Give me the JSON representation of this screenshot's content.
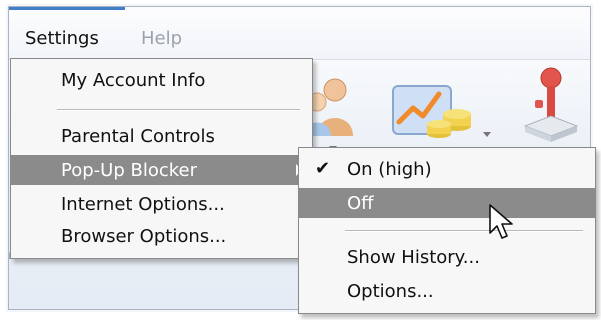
{
  "menubar": {
    "menus": [
      {
        "label": "Settings",
        "accelerator_char": "e",
        "active": true
      },
      {
        "label": "Help",
        "accelerator_char": "H",
        "enabled": false
      }
    ]
  },
  "settings_menu": {
    "items": [
      {
        "label": "My Account Info"
      },
      {
        "label": "Parental Controls"
      },
      {
        "label": "Pop-Up Blocker",
        "highlighted": true,
        "has_submenu": true
      },
      {
        "label": "Internet Options..."
      },
      {
        "label": "Browser Options..."
      }
    ]
  },
  "popup_blocker_submenu": {
    "items": [
      {
        "label": "On (high)",
        "checked": true
      },
      {
        "label": "Off",
        "highlighted": true
      },
      {
        "label": "Show History..."
      },
      {
        "label": "Options..."
      }
    ]
  },
  "toolbar": {
    "icons": [
      "parental-controls-icon",
      "chart-icon",
      "joystick-icon"
    ]
  },
  "colors": {
    "highlight": "#8b8b8b",
    "menu_background": "#f7f7f7",
    "menubar_accent": "#3f7fc8",
    "toolbar_bottom": "#9fb6d3"
  }
}
